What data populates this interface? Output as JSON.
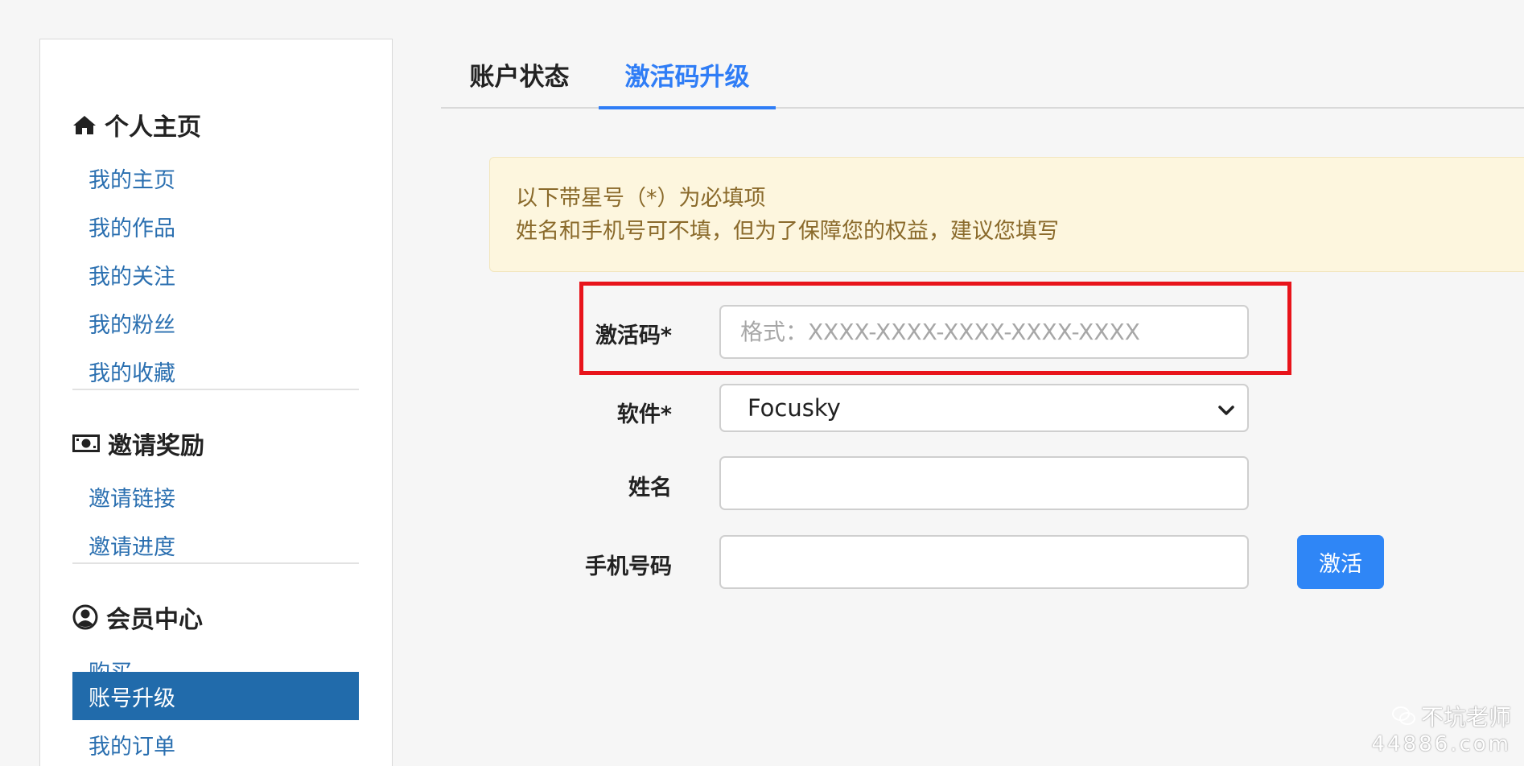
{
  "sidebar": {
    "personal": {
      "title": "个人主页",
      "icon": "home-icon",
      "items": [
        "我的主页",
        "我的作品",
        "我的关注",
        "我的粉丝",
        "我的收藏"
      ]
    },
    "invite": {
      "title": "邀请奖励",
      "icon": "money-icon",
      "items": [
        "邀请链接",
        "邀请进度"
      ]
    },
    "member": {
      "title": "会员中心",
      "icon": "user-circle-icon",
      "items": [
        "购买",
        "账号升级",
        "我的订单"
      ],
      "active_item": "账号升级"
    }
  },
  "tabs": {
    "account_status": "账户状态",
    "activation_upgrade": "激活码升级",
    "active": "激活码升级"
  },
  "alert": {
    "line1": "以下带星号（*）为必填项",
    "line2": "姓名和手机号可不填，但为了保障您的权益，建议您填写"
  },
  "form": {
    "code_label": "激活码*",
    "code_placeholder": "格式：XXXX-XXXX-XXXX-XXXX-XXXX",
    "code_value": "",
    "software_label": "软件*",
    "software_value": "Focusky",
    "name_label": "姓名",
    "name_value": "",
    "phone_label": "手机号码",
    "phone_value": "",
    "submit_label": "激活"
  },
  "watermark": {
    "name": "不坑老师",
    "site": "44886.com"
  },
  "colors": {
    "link": "#2a6fb0",
    "active_nav_bg": "#216bab",
    "tab_active": "#2f7df6",
    "alert_bg": "#fdf6de",
    "alert_text": "#8a6a2b",
    "highlight": "#e8141b",
    "button": "#2f86f6"
  }
}
